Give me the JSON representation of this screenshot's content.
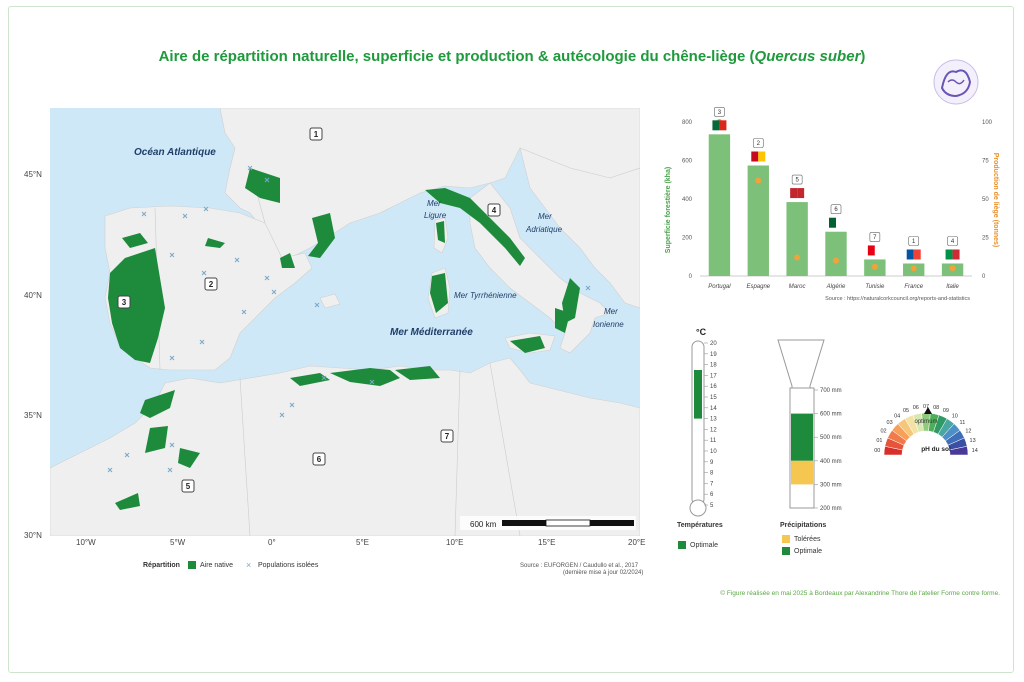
{
  "title_main": "Aire de répartition naturelle, superficie et production & autécologie du chêne-liège (",
  "title_species": "Quercus suber",
  "title_end": ")",
  "colors": {
    "native": "#1e8a3c",
    "bar": "#7cc07a",
    "dot": "#f2a23a",
    "sea": "#cfe8f7",
    "land": "#efefef",
    "title": "#1e9a3c"
  },
  "map": {
    "sea_labels": [
      "Océan Atlantique",
      "Mer",
      "Ligure",
      "Mer",
      "Adriatique",
      "Mer Tyrrhénienne",
      "Mer Méditerranée",
      "Mer",
      "Ionienne"
    ],
    "lat_ticks": [
      "45°N",
      "40°N",
      "35°N",
      "30°N"
    ],
    "lon_ticks": [
      "10°W",
      "5°W",
      "0°",
      "5°E",
      "10°E",
      "15°E",
      "20°E"
    ],
    "badges": [
      "1",
      "2",
      "3",
      "4",
      "5",
      "6",
      "7"
    ],
    "scale": "600 km",
    "legend_title": "Répartition",
    "legend_native": "Aire native",
    "legend_isolated": "Populations isolées",
    "source": "Source : EUFORGEN / Caudullo et al., 2017",
    "source2": "(dernière mise à jour 02/2024)"
  },
  "chart_data": {
    "type": "bar",
    "categories": [
      "Portugal",
      "Espagne",
      "Maroc",
      "Algérie",
      "Tunisie",
      "France",
      "Italie"
    ],
    "ranks": [
      "3",
      "2",
      "5",
      "6",
      "7",
      "1",
      "4"
    ],
    "series": [
      {
        "name": "Superficie forestière (kha)",
        "values": [
          736,
          574,
          384,
          230,
          86,
          65,
          65
        ]
      },
      {
        "name": "Production de liège (tonnes)",
        "values": [
          100,
          62,
          12,
          10,
          6,
          5,
          5
        ]
      }
    ],
    "ylabel_left": "Superficie forestière (kha)",
    "ylabel_right": "Production de liège (tonnes)",
    "yticks_left": [
      "0",
      "200",
      "400",
      "600",
      "800"
    ],
    "yticks_right": [
      "0",
      "25",
      "50",
      "75",
      "100"
    ],
    "ylim_left": [
      0,
      800
    ],
    "ylim_right": [
      0,
      100
    ],
    "source": "Source : https://naturalcorkcouncil.org/reports-and-statistics"
  },
  "temperature": {
    "unit": "°C",
    "ticks": [
      "5",
      "6",
      "7",
      "8",
      "9",
      "10",
      "11",
      "12",
      "13",
      "14",
      "15",
      "16",
      "17",
      "18",
      "19",
      "20"
    ],
    "optimal_range": [
      13,
      17.5
    ],
    "legend_title": "Températures",
    "legend_optimal": "Optimale"
  },
  "precipitation": {
    "ticks": [
      "200 mm",
      "300 mm",
      "400 mm",
      "500 mm",
      "600 mm",
      "700 mm"
    ],
    "tolerated_range": [
      300,
      400
    ],
    "optimal_range": [
      400,
      600
    ],
    "legend_title": "Précipitations",
    "legend_tolerated": "Tolérées",
    "legend_optimal": "Optimale"
  },
  "ph": {
    "labels": [
      "00",
      "01",
      "02",
      "03",
      "04",
      "05",
      "06",
      "07",
      "08",
      "09",
      "10",
      "11",
      "12",
      "13",
      "14"
    ],
    "optimum_label": "optimum",
    "title": "pH du sol"
  },
  "credit": "© Figure réalisée en mai 2025 à Bordeaux par Alexandrine Thore de l'atelier Forme contre forme."
}
